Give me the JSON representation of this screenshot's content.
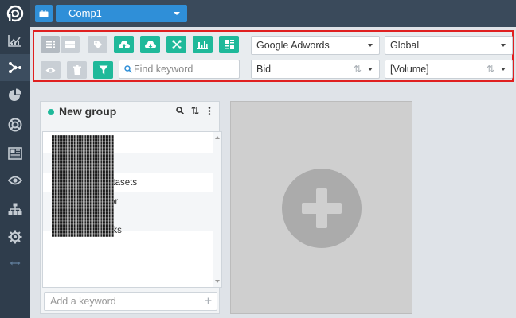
{
  "topbar": {
    "company": "Comp1"
  },
  "sidebar": {
    "items": [
      {
        "icon": "line-chart-icon"
      },
      {
        "icon": "share-nodes-icon",
        "active": true
      },
      {
        "icon": "pie-chart-icon"
      },
      {
        "icon": "lifebuoy-icon"
      },
      {
        "icon": "newspaper-icon"
      },
      {
        "icon": "eye-icon"
      },
      {
        "icon": "sitemap-icon"
      },
      {
        "icon": "gear-icon"
      },
      {
        "icon": "expand-arrows-icon"
      }
    ]
  },
  "toolbar": {
    "search_placeholder": "Find keyword",
    "source": "Google Adwords",
    "region": "Global",
    "metric": "Bid",
    "sort": "[Volume]"
  },
  "group": {
    "title": "New group",
    "rows": [
      "",
      "",
      "",
      "atasets",
      "",
      "or",
      "",
      "oks"
    ],
    "add_placeholder": "Add a keyword",
    "add_symbol": "+"
  },
  "colors": {
    "accent_teal": "#1fb99a",
    "accent_blue": "#2f8fd8",
    "sidebar": "#2f3d4c",
    "highlight_border": "#e02020"
  }
}
